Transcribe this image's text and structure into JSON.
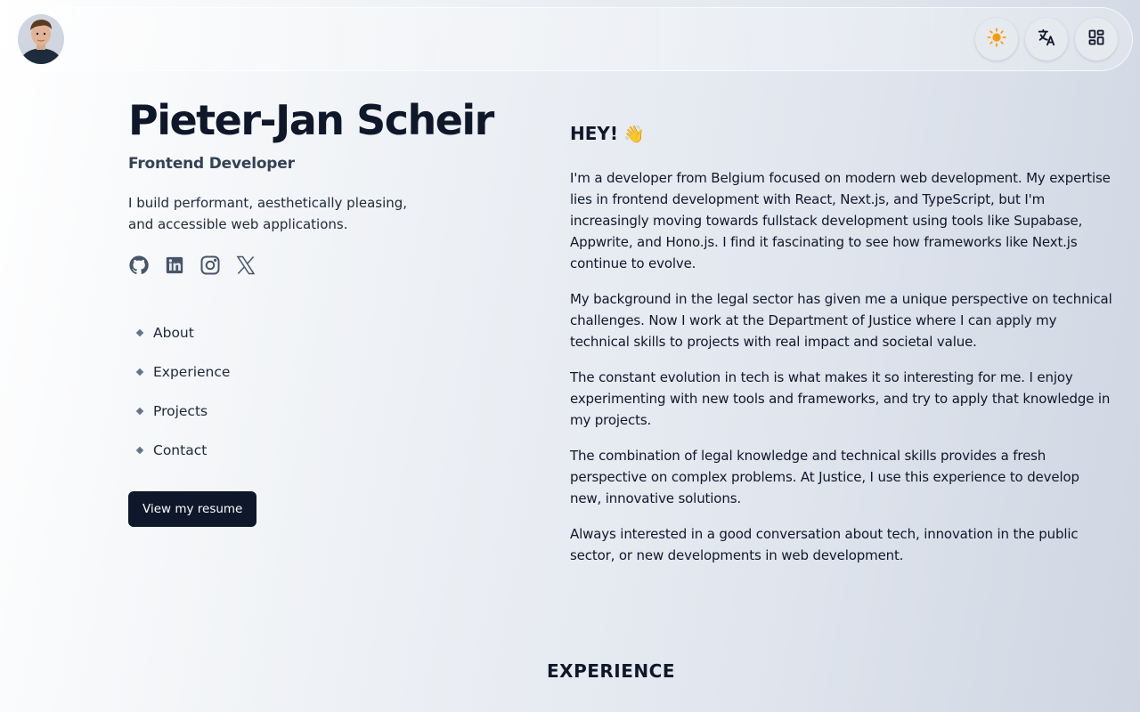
{
  "header": {
    "avatar_alt": "Profile photo",
    "theme_icon": "sun-icon",
    "language_icon": "translate-icon",
    "apps_icon": "grid-icon"
  },
  "profile": {
    "name": "Pieter-Jan Scheir",
    "role": "Frontend Developer",
    "tagline": "I build performant, aesthetically pleasing, and accessible web applications."
  },
  "socials": [
    {
      "icon": "github-icon"
    },
    {
      "icon": "linkedin-icon"
    },
    {
      "icon": "instagram-icon"
    },
    {
      "icon": "x-icon"
    }
  ],
  "nav": [
    {
      "label": "About"
    },
    {
      "label": "Experience"
    },
    {
      "label": "Projects"
    },
    {
      "label": "Contact"
    }
  ],
  "resume_button": "View my resume",
  "about": {
    "heading": "HEY!",
    "heading_emoji": "👋",
    "paragraphs": [
      "I'm a developer from Belgium focused on modern web development. My expertise lies in frontend development with React, Next.js, and TypeScript, but I'm increasingly moving towards fullstack development using tools like Supabase, Appwrite, and Hono.js. I find it fascinating to see how frameworks like Next.js continue to evolve.",
      "My background in the legal sector has given me a unique perspective on technical challenges. Now I work at the Department of Justice where I can apply my technical skills to projects with real impact and societal value.",
      "The constant evolution in tech is what makes it so interesting for me. I enjoy experimenting with new tools and frameworks, and try to apply that knowledge in my projects.",
      "The combination of legal knowledge and technical skills provides a fresh perspective on complex problems. At Justice, I use this experience to develop new, innovative solutions.",
      "Always interested in a good conversation about tech, innovation in the public sector, or new developments in web development."
    ]
  },
  "experience_heading": "EXPERIENCE",
  "colors": {
    "primary": "#0f172a",
    "muted": "#334155",
    "icon": "#475569",
    "sun": "#f59e0b"
  }
}
